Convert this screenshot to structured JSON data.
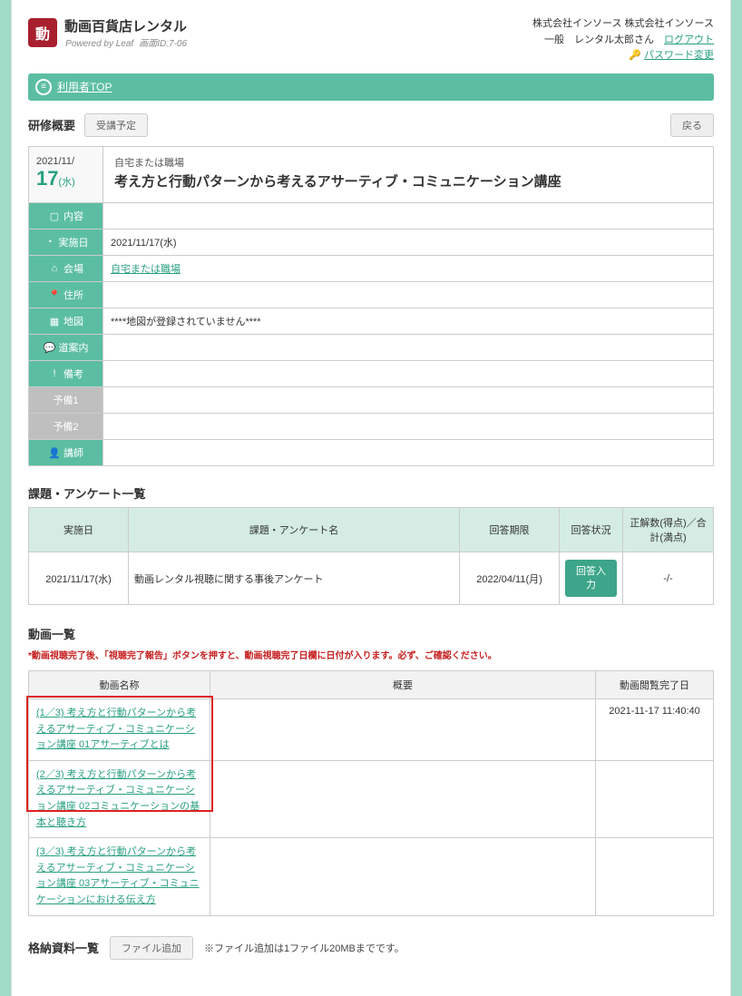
{
  "header": {
    "logo_text": "動画百貨店レンタル",
    "powered": "Powered by Leaf",
    "screen_id": "画面ID:7-06",
    "company": "株式会社インソース 株式会社インソース",
    "user_line_prefix": "一般　レンタル太郎さん　",
    "logout": "ログアウト",
    "pw_change": "パスワード変更"
  },
  "nav": {
    "top_label": "利用者TOP"
  },
  "overview": {
    "section_title": "研修概要",
    "btn_schedule": "受講予定",
    "btn_back": "戻る",
    "date_top": "2021/11/",
    "date_day": "17",
    "date_wd": "(水)",
    "location_sub": "自宅または職場",
    "course_title": "考え方と行動パターンから考えるアサーティブ・コミュニケーション講座",
    "rows": {
      "content_label": "内容",
      "content_val": "",
      "date_label": "実施日",
      "date_val": "2021/11/17(水)",
      "venue_label": "会場",
      "venue_val": "自宅または職場",
      "address_label": "住所",
      "address_val": "",
      "map_label": "地図",
      "map_val": "****地図が登録されていません****",
      "guide_label": "道案内",
      "guide_val": "",
      "note_label": "備考",
      "note_val": "",
      "pre1_label": "予備1",
      "pre1_val": "",
      "pre2_label": "予備2",
      "pre2_val": "",
      "instructor_label": "講師",
      "instructor_val": ""
    }
  },
  "survey": {
    "section_title": "課題・アンケート一覧",
    "cols": {
      "date": "実施日",
      "name": "課題・アンケート名",
      "deadline": "回答期限",
      "status": "回答状況",
      "score": "正解数(得点)／合計(満点)"
    },
    "row": {
      "date": "2021/11/17(水)",
      "name": "動画レンタル視聴に関する事後アンケート",
      "deadline": "2022/04/11(月)",
      "status_btn": "回答入力",
      "score": "-/-"
    }
  },
  "videos": {
    "section_title": "動画一覧",
    "warning": "*動画視聴完了後、「視聴完了報告」ボタンを押すと、動画視聴完了日欄に日付が入ります。必ず、ご確認ください。",
    "cols": {
      "name": "動画名称",
      "summary": "概要",
      "done": "動画閲覧完了日"
    },
    "rows": [
      {
        "name": "(1／3) 考え方と行動パターンから考えるアサーティブ・コミュニケーション講座 01アサーティブとは",
        "done": "2021-11-17 11:40:40"
      },
      {
        "name": "(2／3) 考え方と行動パターンから考えるアサーティブ・コミュニケーション講座 02コミュニケーションの基本と聴き方",
        "done": ""
      },
      {
        "name": "(3／3) 考え方と行動パターンから考えるアサーティブ・コミュニケーション講座 03アサーティブ・コミュニケーションにおける伝え方",
        "done": ""
      }
    ]
  },
  "stored": {
    "section_title": "格納資料一覧",
    "btn_add": "ファイル追加",
    "note": "※ファイル追加は1ファイル20MBまでです。"
  }
}
